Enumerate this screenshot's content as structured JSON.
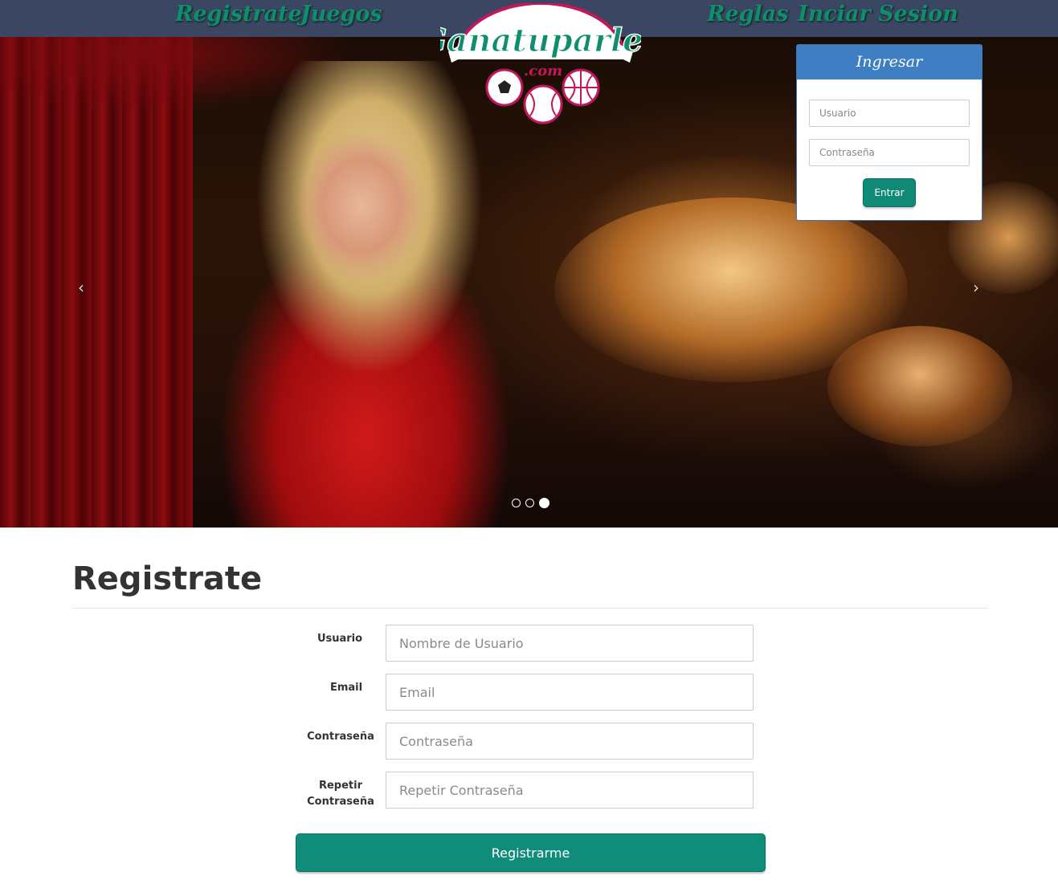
{
  "nav": {
    "registrate": "Registrate",
    "juegos": "Juegos",
    "reglas": "Reglas",
    "iniciar_sesion": "Inciar Sesion"
  },
  "logo": {
    "text": "Ganatuparley",
    "suffix": ".com"
  },
  "login": {
    "title": "Ingresar",
    "user_placeholder": "Usuario",
    "pass_placeholder": "Contraseña",
    "button": "Entrar"
  },
  "carousel": {
    "prev_icon": "‹",
    "next_icon": "›",
    "slides": 3,
    "active_slide": 3
  },
  "register": {
    "title": "Registrate",
    "fields": [
      {
        "label": "Usuario",
        "placeholder": "Nombre de Usuario"
      },
      {
        "label": "Email",
        "placeholder": "Email"
      },
      {
        "label": "Contraseña",
        "placeholder": "Contraseña"
      },
      {
        "label": "Repetir Contraseña",
        "placeholder": "Repetir Contraseña"
      }
    ],
    "button": "Registrarme"
  },
  "colors": {
    "nav_bg": "#3b4662",
    "nav_text": "#0f8e6e",
    "accent_green": "#0f8c7a",
    "login_header": "#3e7ec3"
  }
}
